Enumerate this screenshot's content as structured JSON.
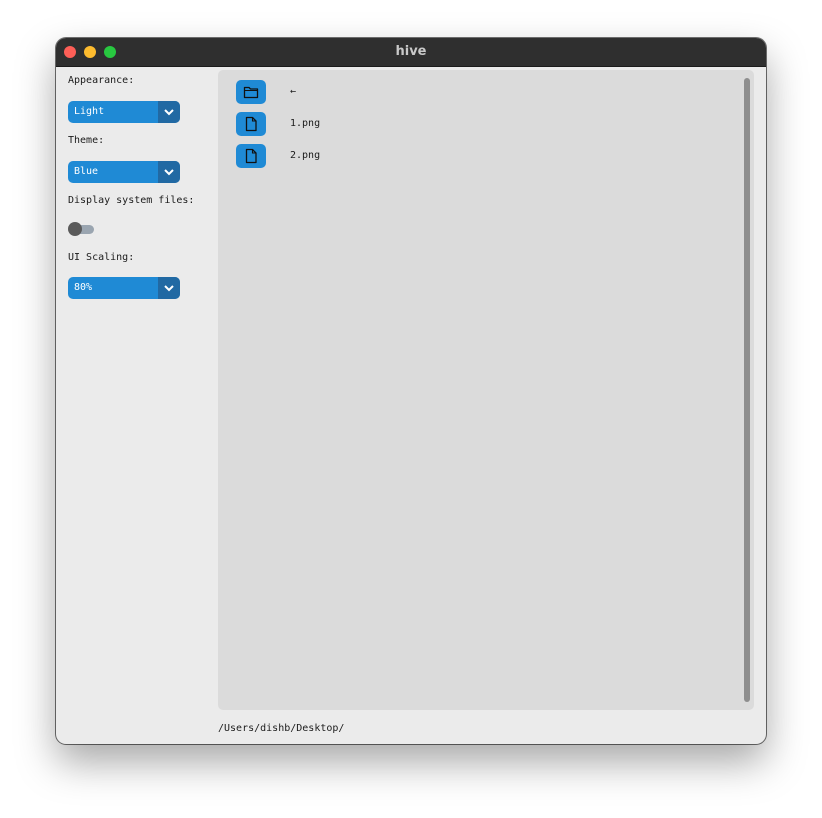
{
  "window": {
    "title": "hive"
  },
  "sidebar": {
    "appearance_label": "Appearance:",
    "appearance_value": "Light",
    "theme_label": "Theme:",
    "theme_value": "Blue",
    "system_files_label": "Display system files:",
    "system_files_enabled": false,
    "scaling_label": "UI Scaling:",
    "scaling_value": "80%"
  },
  "files": [
    {
      "icon": "folder-icon",
      "name": "←"
    },
    {
      "icon": "file-icon",
      "name": "1.png"
    },
    {
      "icon": "file-icon",
      "name": "2.png"
    }
  ],
  "status": {
    "path": "/Users/dishb/Desktop/"
  },
  "colors": {
    "accent": "#1f8ad5",
    "accent_dark": "#2169a3",
    "titlebar": "#2f2f2f",
    "panel": "#dbdbdb"
  }
}
